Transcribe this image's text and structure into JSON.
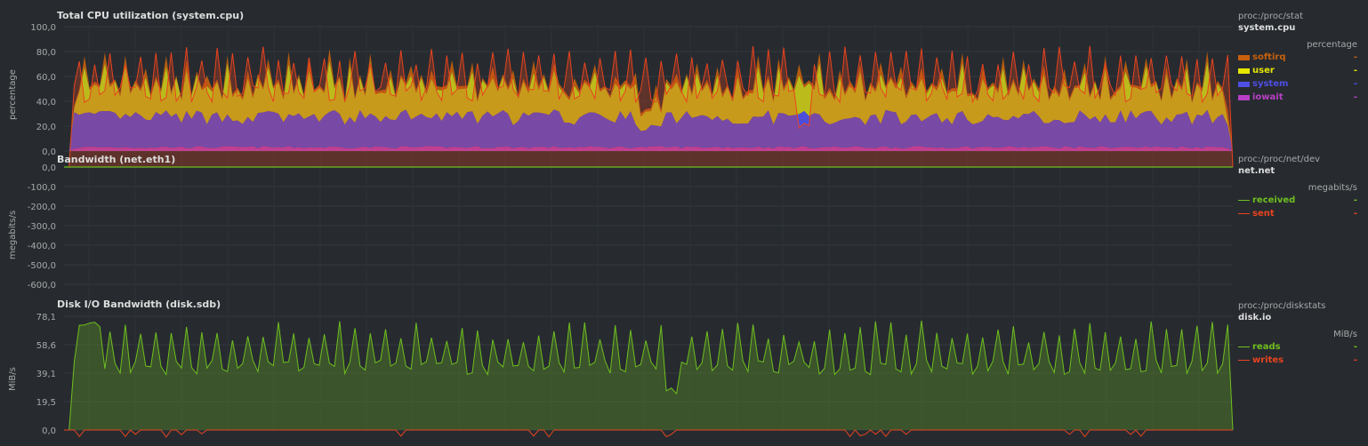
{
  "charts": [
    {
      "title": "Total CPU utilization (system.cpu)",
      "source": "proc:/proc/stat",
      "context": "system.cpu",
      "units": "percentage",
      "ylabel": "percentage",
      "ticks": [
        "100,0",
        "80,0",
        "60,0",
        "40,0",
        "20,0",
        "0,0"
      ],
      "dimensions": [
        {
          "name": "softirq",
          "color": "#c7600c",
          "value": "-"
        },
        {
          "name": "user",
          "color": "#e6e600",
          "value": "-"
        },
        {
          "name": "system",
          "color": "#4f4fe6",
          "value": "-"
        },
        {
          "name": "iowait",
          "color": "#b73fc6",
          "value": "-"
        }
      ]
    },
    {
      "title": "Bandwidth (net.eth1)",
      "source": "proc:/proc/net/dev",
      "context": "net.net",
      "units": "megabits/s",
      "ylabel": "megabits/s",
      "ticks": [
        "0,0",
        "-100,0",
        "-200,0",
        "-300,0",
        "-400,0",
        "-500,0",
        "-600,0"
      ],
      "dimensions": [
        {
          "name": "received",
          "color": "#6fbf1f",
          "value": "-"
        },
        {
          "name": "sent",
          "color": "#e8431e",
          "value": "-"
        }
      ]
    },
    {
      "title": "Disk I/O Bandwidth (disk.sdb)",
      "source": "proc:/proc/diskstats",
      "context": "disk.io",
      "units": "MiB/s",
      "ylabel": "MiB/s",
      "ticks": [
        "78,1",
        "58,6",
        "39,1",
        "19,5",
        "0,0"
      ],
      "dimensions": [
        {
          "name": "reads",
          "color": "#6fbf1f",
          "value": "-"
        },
        {
          "name": "writes",
          "color": "#e8431e",
          "value": "-"
        }
      ]
    }
  ]
}
